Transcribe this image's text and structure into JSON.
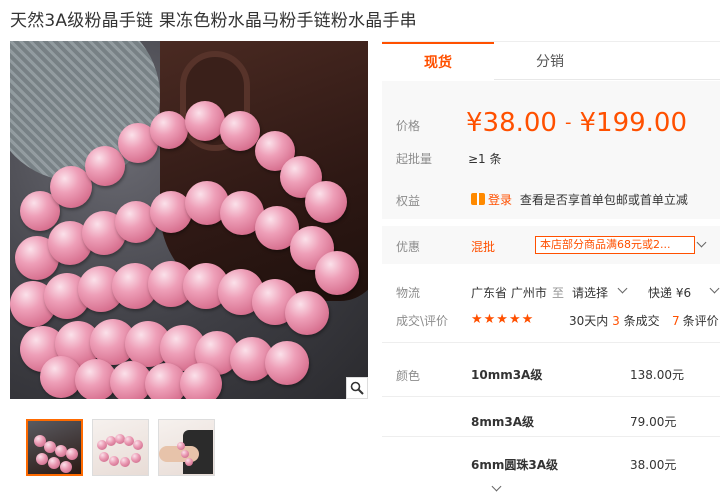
{
  "title": "天然3A级粉晶手链 果冻色粉水晶马粉手链粉水晶手串",
  "image": {
    "zoom_icon": "search-icon"
  },
  "thumbnails": [
    {
      "icon": "bracelet-thumbnail",
      "active": true
    },
    {
      "icon": "bracelet-thumbnail",
      "active": false
    },
    {
      "icon": "bracelet-on-wrist-thumbnail",
      "active": false
    }
  ],
  "tabs": {
    "current": "现货",
    "distribution": "分销"
  },
  "price": {
    "label": "价格",
    "low": "¥38.00",
    "separator": "-",
    "high": "¥199.00",
    "moq_label": "起批量",
    "moq_value": "≥1 条"
  },
  "benefits": {
    "label": "权益",
    "badge": "登录",
    "text": "查看是否享首单包邮或首单立减"
  },
  "promotion": {
    "label": "优惠",
    "type": "混批",
    "tag": "本店部分商品满68元或2..."
  },
  "logistics": {
    "label": "物流",
    "origin": "广东省 广州市",
    "to": "至",
    "destination": "请选择",
    "shipping": "快递 ¥6"
  },
  "reviews": {
    "label": "成交\\评价",
    "stars": "★★★★★",
    "deals_prefix": "30天内",
    "deals_count": "3",
    "deals_suffix": "条成交",
    "review_count": "7",
    "review_suffix": "条评价"
  },
  "sku": {
    "label": "颜色",
    "items": [
      {
        "name": "10mm3A级",
        "price": "138.00元"
      },
      {
        "name": "8mm3A级",
        "price": "79.00元"
      },
      {
        "name": "6mm圆珠3A级",
        "price": "38.00元"
      }
    ]
  }
}
